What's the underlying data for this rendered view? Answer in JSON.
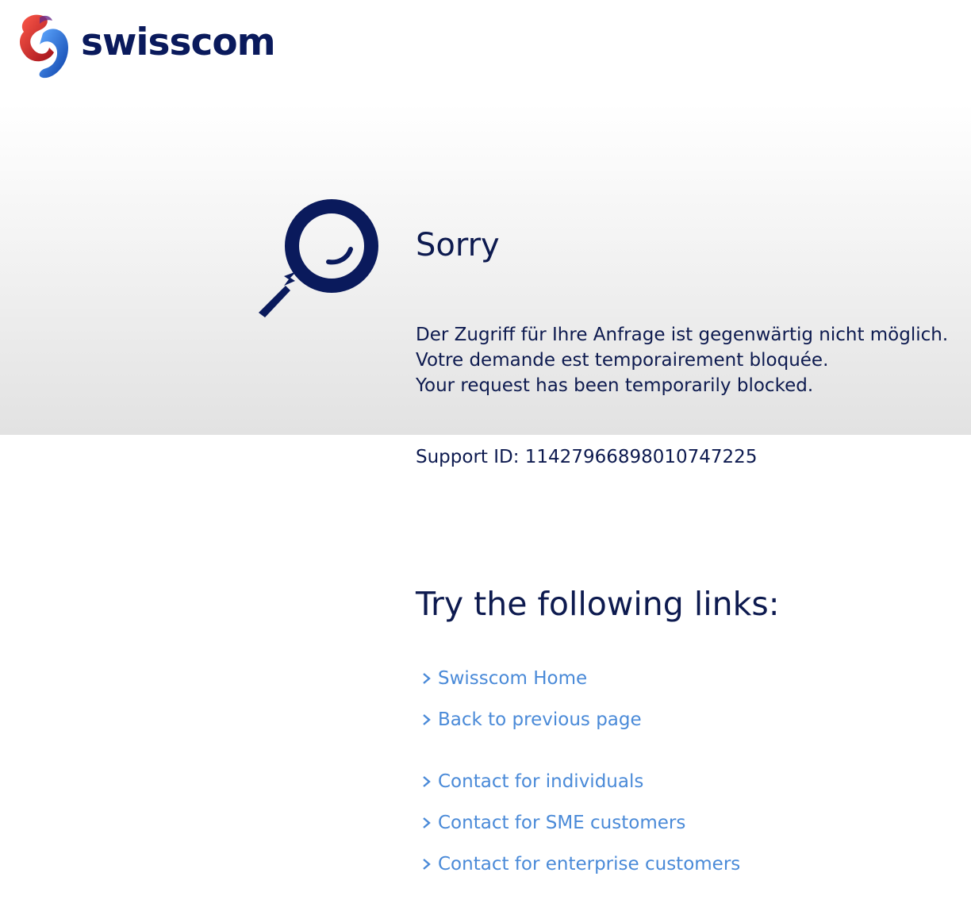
{
  "header": {
    "brand_name": "swisscom",
    "logo_icon": "swisscom-lifeform-icon"
  },
  "error": {
    "illustration_icon": "magnifier-smile-icon",
    "title": "Sorry",
    "message_de": "Der Zugriff für Ihre Anfrage ist gegenwärtig nicht möglich.",
    "message_fr": "Votre demande est temporairement bloquée.",
    "message_en": "Your request has been temporarily blocked.",
    "support_id": "Support ID: 11427966898010747225"
  },
  "links": {
    "title": "Try the following links:",
    "items": [
      {
        "label": "Swisscom Home"
      },
      {
        "label": "Back to previous page"
      },
      {
        "label": "Contact for individuals"
      },
      {
        "label": "Contact for SME customers"
      },
      {
        "label": "Contact for enterprise customers"
      }
    ]
  },
  "colors": {
    "navy": "#0d1a4f",
    "link_blue": "#4a8ad8",
    "brand_red": "#d9281e",
    "brand_blue": "#1f6ed6"
  }
}
